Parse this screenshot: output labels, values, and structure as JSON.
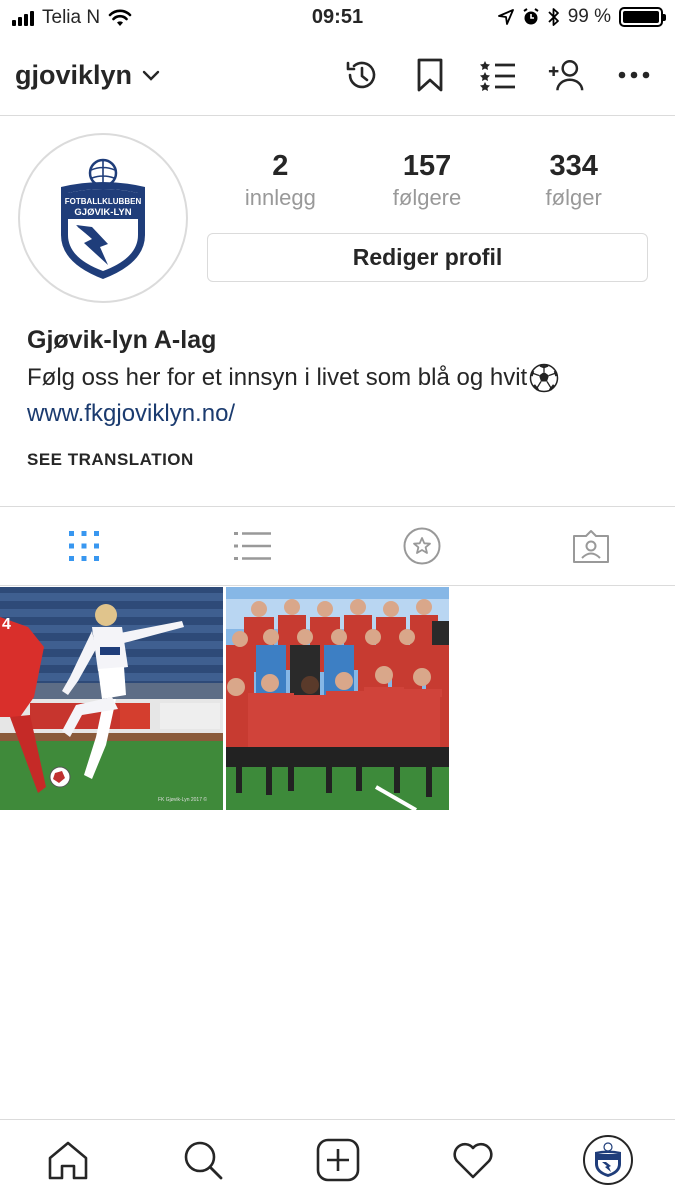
{
  "status_bar": {
    "carrier": "Telia N",
    "time": "09:51",
    "battery_percent": "99 %",
    "battery_level": 0.99
  },
  "header": {
    "username": "gjoviklyn",
    "icons": [
      "archive-icon",
      "bookmark-icon",
      "discover-people-list-icon",
      "add-person-icon",
      "more-icon"
    ]
  },
  "profile": {
    "avatar_text_top": "FOTBALLKLUBBEN",
    "avatar_text_bottom": "GJØVIK-LYN",
    "stats": [
      {
        "value": "2",
        "label": "innlegg"
      },
      {
        "value": "157",
        "label": "følgere"
      },
      {
        "value": "334",
        "label": "følger"
      }
    ],
    "edit_button": "Rediger profil",
    "name": "Gjøvik-lyn A-lag",
    "bio": "Følg oss her for et innsyn i livet som blå og hvit",
    "link": "www.fkgjoviklyn.no/",
    "see_translation": "SEE TRANSLATION"
  },
  "tabs": [
    "grid-icon",
    "list-icon",
    "saved-star-icon",
    "tagged-icon"
  ],
  "posts": [
    {
      "caption_small": "FK Gjøvik-Lyn 2017 ©"
    },
    {}
  ],
  "bottom_nav": [
    "home-icon",
    "search-icon",
    "new-post-icon",
    "activity-heart-icon",
    "profile-avatar"
  ],
  "colors": {
    "accent_blue": "#3897f0",
    "link_blue": "#1b3b6f",
    "club_navy": "#1f3d7a",
    "border": "#dbdbdb"
  }
}
